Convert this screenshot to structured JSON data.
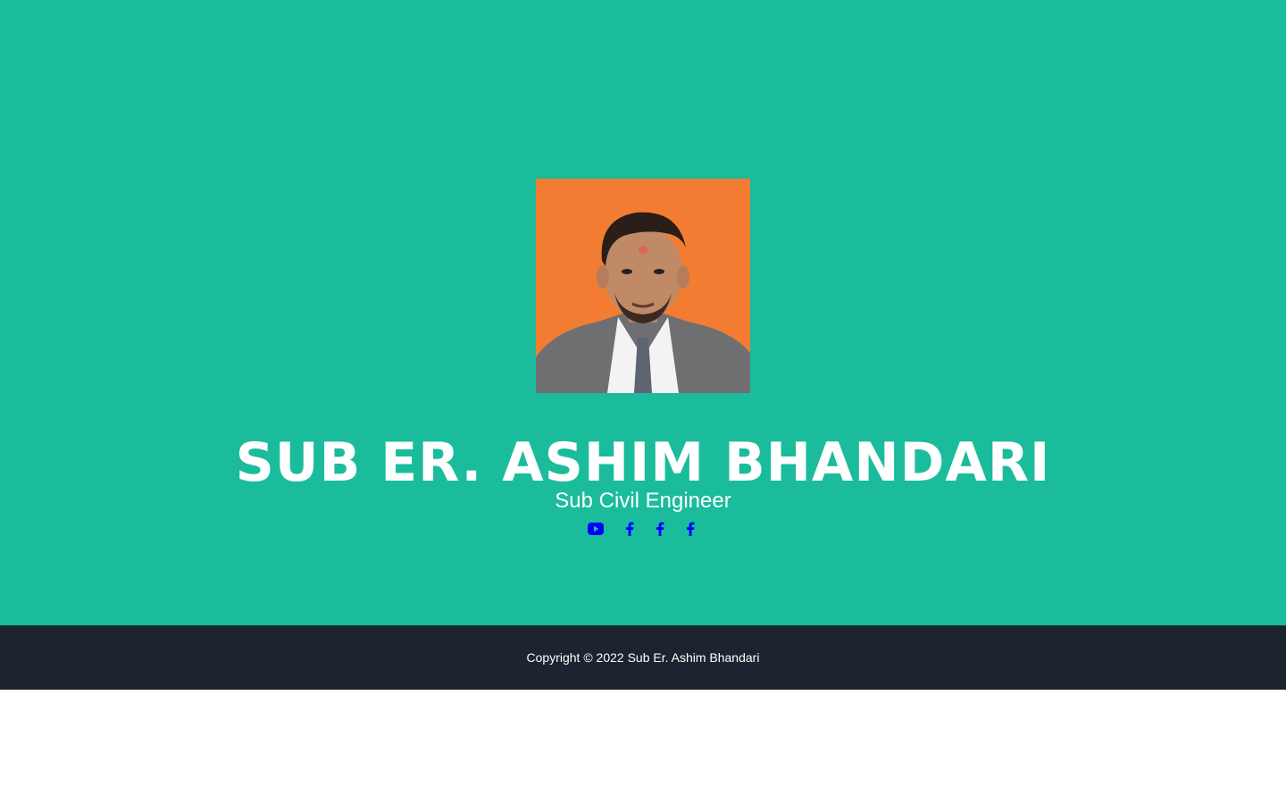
{
  "hero": {
    "name": "SUB ER. ASHIM BHANDARI",
    "title": "Sub Civil Engineer",
    "background_color": "#1abc9c",
    "avatar_icon": "profile-photo"
  },
  "socials": [
    {
      "icon": "youtube-icon",
      "color": "#0000ff"
    },
    {
      "icon": "facebook-icon",
      "color": "#0000ff"
    },
    {
      "icon": "facebook-icon",
      "color": "#0000ff"
    },
    {
      "icon": "facebook-icon",
      "color": "#0000ff"
    }
  ],
  "footer": {
    "copyright": "Copyright © 2022 Sub Er. Ashim Bhandari",
    "background_color": "#1d242f"
  }
}
